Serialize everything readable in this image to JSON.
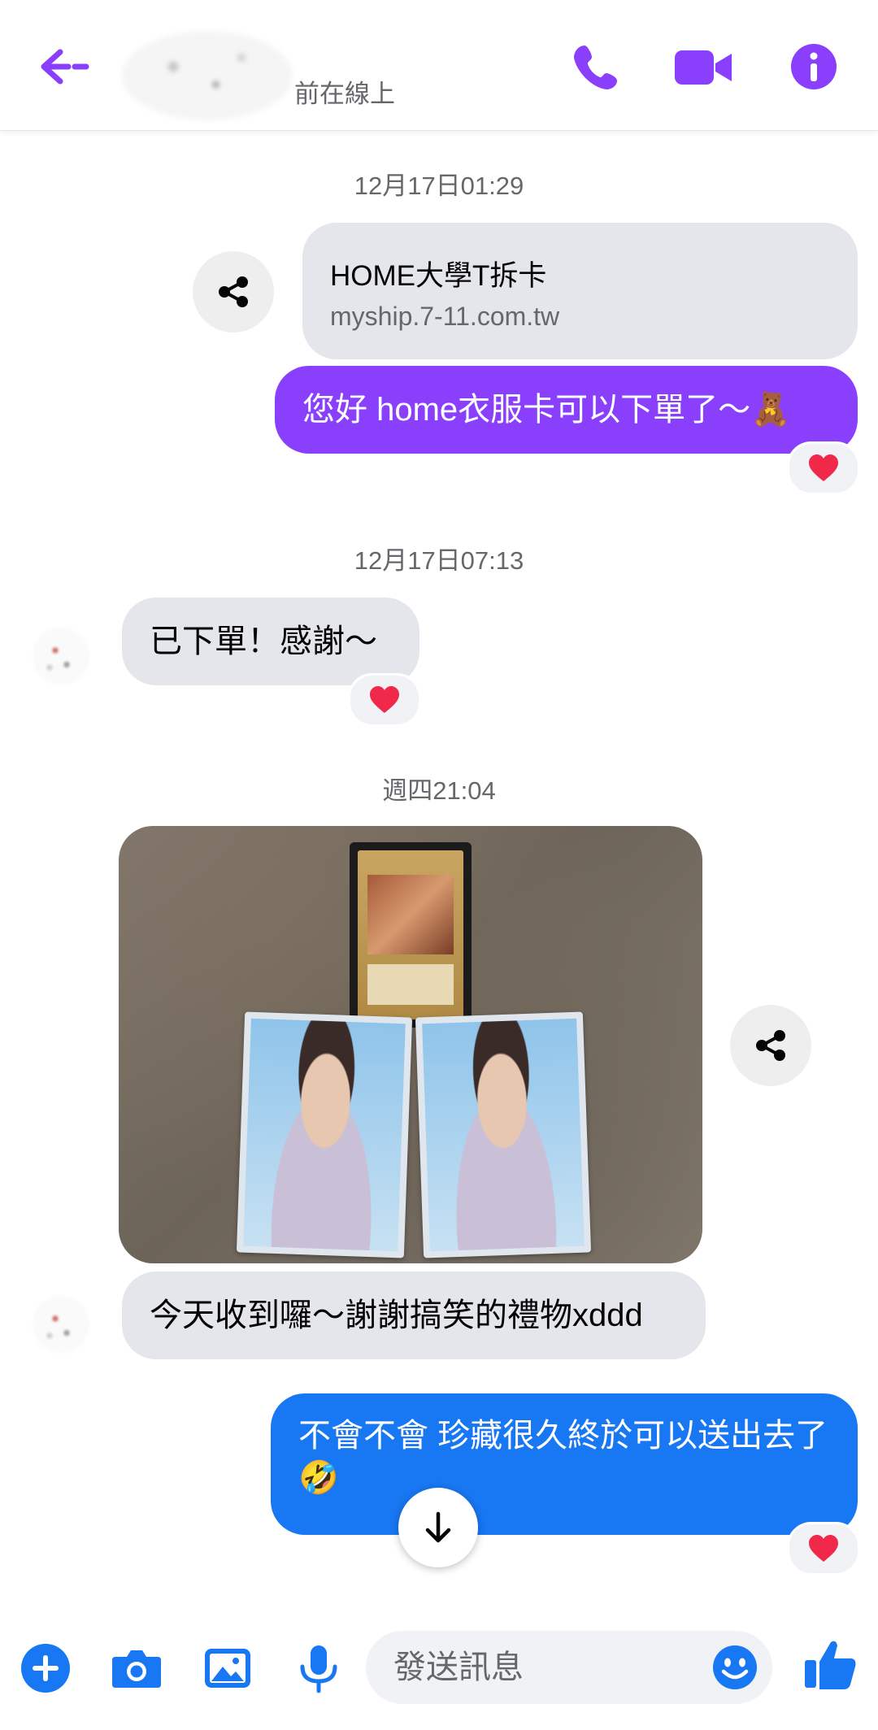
{
  "header": {
    "status": "前在線上",
    "accent_color": "#8a3ffc"
  },
  "timestamps": [
    "12月17日01:29",
    "12月17日07:13",
    "週四21:04"
  ],
  "link_preview": {
    "title": "HOME大學T拆卡",
    "url": "myship.7-11.com.tw"
  },
  "messages": {
    "out_1": "您好 home衣服卡可以下單了～",
    "out_1_emoji": "🧸",
    "in_1": "已下單！感謝～",
    "in_2": "今天收到囉～謝謝搞笑的禮物xddd",
    "out_2": "不會不會 珍藏很久終於可以送出去了",
    "out_2_emoji": "🤣"
  },
  "reactions": {
    "heart": "heart-icon",
    "color": "#f02849"
  },
  "composer": {
    "placeholder": "發送訊息"
  },
  "icons": {
    "back": "back-arrow-icon",
    "call": "phone-icon",
    "video": "video-camera-icon",
    "info": "info-icon",
    "share": "share-icon",
    "scroll": "arrow-down-icon",
    "plus": "plus-icon",
    "camera": "camera-icon",
    "gallery": "image-icon",
    "mic": "microphone-icon",
    "emoji": "emoji-icon",
    "like": "thumbs-up-icon"
  },
  "colors": {
    "purple_bubble": "#8a3ffc",
    "blue_bubble": "#1877f2",
    "incoming_bubble": "#e4e6eb",
    "composer_icons": "#1877f2"
  }
}
